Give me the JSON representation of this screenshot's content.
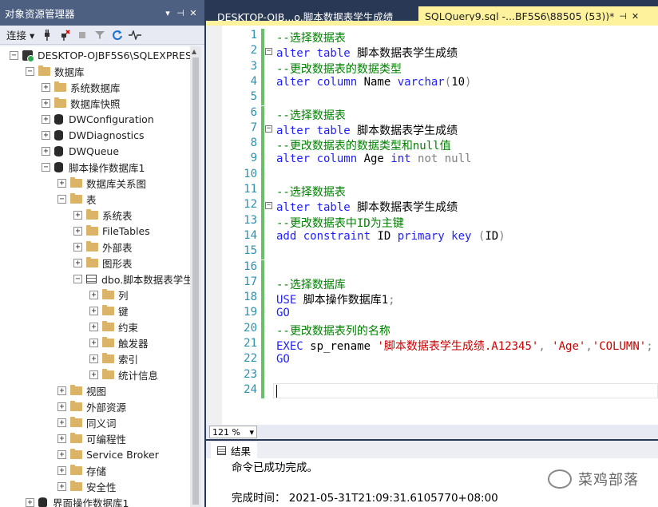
{
  "object_explorer": {
    "title": "对象资源管理器",
    "controls": {
      "dropdown": "▾",
      "pin": "📌",
      "close": "✕"
    },
    "toolbar": {
      "connect": "连接 ▾"
    },
    "tree": [
      {
        "label": "DESKTOP-OJBF5S6\\SQLEXPRESS",
        "exp": "−",
        "icon": "server-icon"
      },
      {
        "label": "数据库",
        "exp": "−",
        "icon": "folder-icon"
      },
      {
        "label": "系统数据库",
        "exp": "+",
        "icon": "folder-icon"
      },
      {
        "label": "数据库快照",
        "exp": "+",
        "icon": "folder-icon"
      },
      {
        "label": "DWConfiguration",
        "exp": "+",
        "icon": "database-icon"
      },
      {
        "label": "DWDiagnostics",
        "exp": "+",
        "icon": "database-icon"
      },
      {
        "label": "DWQueue",
        "exp": "+",
        "icon": "database-icon"
      },
      {
        "label": "脚本操作数据库1",
        "exp": "−",
        "icon": "database-icon"
      },
      {
        "label": "数据库关系图",
        "exp": "+",
        "icon": "folder-icon"
      },
      {
        "label": "表",
        "exp": "−",
        "icon": "folder-icon"
      },
      {
        "label": "系统表",
        "exp": "+",
        "icon": "folder-icon"
      },
      {
        "label": "FileTables",
        "exp": "+",
        "icon": "folder-icon"
      },
      {
        "label": "外部表",
        "exp": "+",
        "icon": "folder-icon"
      },
      {
        "label": "图形表",
        "exp": "+",
        "icon": "folder-icon"
      },
      {
        "label": "dbo.脚本数据表学生",
        "exp": "−",
        "icon": "table-icon"
      },
      {
        "label": "列",
        "exp": "+",
        "icon": "folder-icon"
      },
      {
        "label": "键",
        "exp": "+",
        "icon": "folder-icon"
      },
      {
        "label": "约束",
        "exp": "+",
        "icon": "folder-icon"
      },
      {
        "label": "触发器",
        "exp": "+",
        "icon": "folder-icon"
      },
      {
        "label": "索引",
        "exp": "+",
        "icon": "folder-icon"
      },
      {
        "label": "统计信息",
        "exp": "+",
        "icon": "folder-icon"
      },
      {
        "label": "视图",
        "exp": "+",
        "icon": "folder-icon"
      },
      {
        "label": "外部资源",
        "exp": "+",
        "icon": "folder-icon"
      },
      {
        "label": "同义词",
        "exp": "+",
        "icon": "folder-icon"
      },
      {
        "label": "可编程性",
        "exp": "+",
        "icon": "folder-icon"
      },
      {
        "label": "Service Broker",
        "exp": "+",
        "icon": "folder-icon"
      },
      {
        "label": "存储",
        "exp": "+",
        "icon": "folder-icon"
      },
      {
        "label": "安全性",
        "exp": "+",
        "icon": "folder-icon"
      },
      {
        "label": "界面操作数据库1",
        "exp": "+",
        "icon": "database-icon"
      }
    ]
  },
  "tabs": {
    "inactive": "DESKTOP-OJB...o.脚本数据表学生成绩",
    "active": "SQLQuery9.sql -...BF5S6\\88505 (53))*",
    "pin": "⊣",
    "close": "✕"
  },
  "editor": {
    "lines": [
      {
        "n": "1",
        "segs": [
          {
            "t": "--选择数据表",
            "c": "cm"
          }
        ]
      },
      {
        "n": "2",
        "segs": [
          {
            "t": "alter table ",
            "c": "kw"
          },
          {
            "t": "脚本数据表学生成绩",
            "c": ""
          }
        ],
        "fold": "−"
      },
      {
        "n": "3",
        "segs": [
          {
            "t": "--更改数据表的数据类型",
            "c": "cm"
          }
        ]
      },
      {
        "n": "4",
        "segs": [
          {
            "t": "alter column ",
            "c": "kw"
          },
          {
            "t": "Name ",
            "c": ""
          },
          {
            "t": "varchar",
            "c": "kw"
          },
          {
            "t": "(",
            "c": "gy"
          },
          {
            "t": "10",
            "c": ""
          },
          {
            "t": ")",
            "c": "gy"
          }
        ]
      },
      {
        "n": "5",
        "segs": []
      },
      {
        "n": "6",
        "segs": [
          {
            "t": "--选择数据表",
            "c": "cm"
          }
        ]
      },
      {
        "n": "7",
        "segs": [
          {
            "t": "alter table ",
            "c": "kw"
          },
          {
            "t": "脚本数据表学生成绩",
            "c": ""
          }
        ],
        "fold": "−"
      },
      {
        "n": "8",
        "segs": [
          {
            "t": "--更改数据表的数据类型和null值",
            "c": "cm"
          }
        ]
      },
      {
        "n": "9",
        "segs": [
          {
            "t": "alter column ",
            "c": "kw"
          },
          {
            "t": "Age ",
            "c": ""
          },
          {
            "t": "int ",
            "c": "kw"
          },
          {
            "t": "not null",
            "c": "gy"
          }
        ]
      },
      {
        "n": "10",
        "segs": []
      },
      {
        "n": "11",
        "segs": [
          {
            "t": "--选择数据表",
            "c": "cm"
          }
        ]
      },
      {
        "n": "12",
        "segs": [
          {
            "t": "alter table ",
            "c": "kw"
          },
          {
            "t": "脚本数据表学生成绩",
            "c": ""
          }
        ],
        "fold": "−"
      },
      {
        "n": "13",
        "segs": [
          {
            "t": "--更改数据表中ID为主键",
            "c": "cm"
          }
        ]
      },
      {
        "n": "14",
        "segs": [
          {
            "t": "add constraint ",
            "c": "kw"
          },
          {
            "t": "ID ",
            "c": ""
          },
          {
            "t": "primary key ",
            "c": "kw"
          },
          {
            "t": "(",
            "c": "gy"
          },
          {
            "t": "ID",
            "c": ""
          },
          {
            "t": ")",
            "c": "gy"
          }
        ]
      },
      {
        "n": "15",
        "segs": []
      },
      {
        "n": "16",
        "segs": []
      },
      {
        "n": "17",
        "segs": [
          {
            "t": "--选择数据库",
            "c": "cm"
          }
        ]
      },
      {
        "n": "18",
        "segs": [
          {
            "t": "USE ",
            "c": "kw"
          },
          {
            "t": "脚本操作数据库1",
            "c": ""
          },
          {
            "t": ";",
            "c": "gy"
          }
        ]
      },
      {
        "n": "19",
        "segs": [
          {
            "t": "GO",
            "c": "kw"
          }
        ]
      },
      {
        "n": "20",
        "segs": [
          {
            "t": "--更改数据表列的名称",
            "c": "cm"
          }
        ]
      },
      {
        "n": "21",
        "segs": [
          {
            "t": "EXEC ",
            "c": "kw"
          },
          {
            "t": "sp_rename ",
            "c": ""
          },
          {
            "t": "'脚本数据表学生成绩.A12345'",
            "c": "str"
          },
          {
            "t": ", ",
            "c": "gy"
          },
          {
            "t": "'Age'",
            "c": "str"
          },
          {
            "t": ",",
            "c": "gy"
          },
          {
            "t": "'COLUMN'",
            "c": "str"
          },
          {
            "t": ";",
            "c": "gy"
          }
        ]
      },
      {
        "n": "22",
        "segs": [
          {
            "t": "GO",
            "c": "kw"
          }
        ]
      },
      {
        "n": "23",
        "segs": []
      },
      {
        "n": "24",
        "segs": []
      }
    ]
  },
  "status": {
    "zoom": "121 %"
  },
  "results": {
    "tab_label": "结果",
    "message": "命令已成功完成。",
    "completion_time": "完成时间： 2021-05-31T21:09:31.6105770+08:00"
  },
  "watermark": "菜鸡部落",
  "colors": {
    "title_bar": "#4d6082",
    "active_tab": "#fff29d",
    "keyword": "#1f1fff",
    "comment": "#008000",
    "string": "#c80000"
  }
}
